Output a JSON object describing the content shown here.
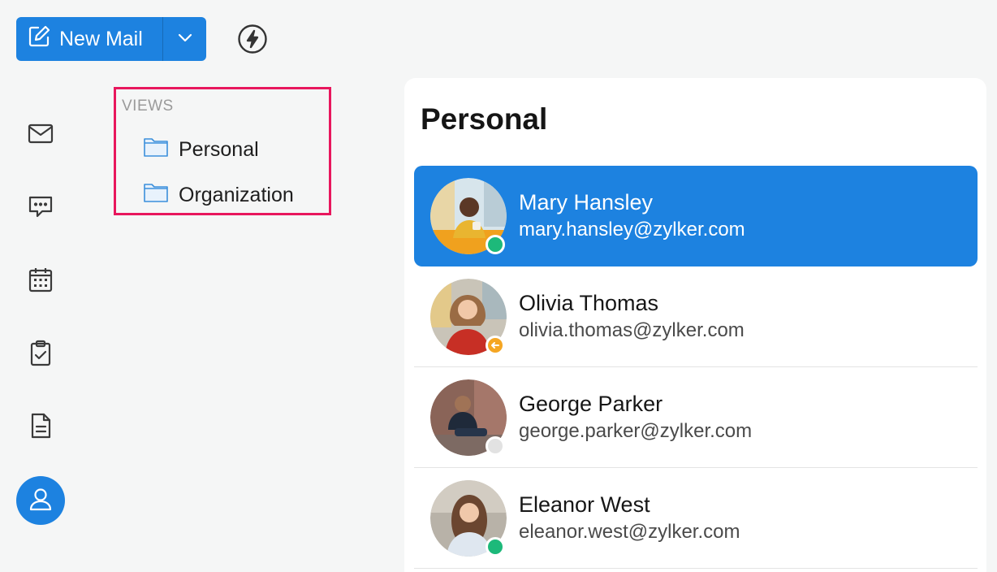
{
  "toolbar": {
    "new_mail_label": "New Mail",
    "accent": "#1d82e0"
  },
  "rail": {
    "items": [
      {
        "name": "mail",
        "icon": "mail-icon"
      },
      {
        "name": "chat",
        "icon": "chat-icon"
      },
      {
        "name": "calendar",
        "icon": "calendar-icon"
      },
      {
        "name": "tasks",
        "icon": "clipboard-check-icon"
      },
      {
        "name": "notes",
        "icon": "note-icon"
      },
      {
        "name": "contacts",
        "icon": "user-icon",
        "active": true
      }
    ]
  },
  "views": {
    "heading": "VIEWS",
    "items": [
      {
        "label": "Personal",
        "icon": "folder-icon"
      },
      {
        "label": "Organization",
        "icon": "folder-icon"
      }
    ],
    "highlight_color": "#e8175d"
  },
  "contacts": {
    "title": "Personal",
    "items": [
      {
        "name": "Mary Hansley",
        "email": "mary.hansley@zylker.com",
        "status": "online",
        "status_color": "#1db97a",
        "selected": true
      },
      {
        "name": "Olivia Thomas",
        "email": "olivia.thomas@zylker.com",
        "status": "away",
        "status_color": "#f5a623",
        "selected": false
      },
      {
        "name": "George Parker",
        "email": "george.parker@zylker.com",
        "status": "offline",
        "status_color": "#e2e2e2",
        "selected": false
      },
      {
        "name": "Eleanor West",
        "email": "eleanor.west@zylker.com",
        "status": "online",
        "status_color": "#1db97a",
        "selected": false
      }
    ]
  }
}
